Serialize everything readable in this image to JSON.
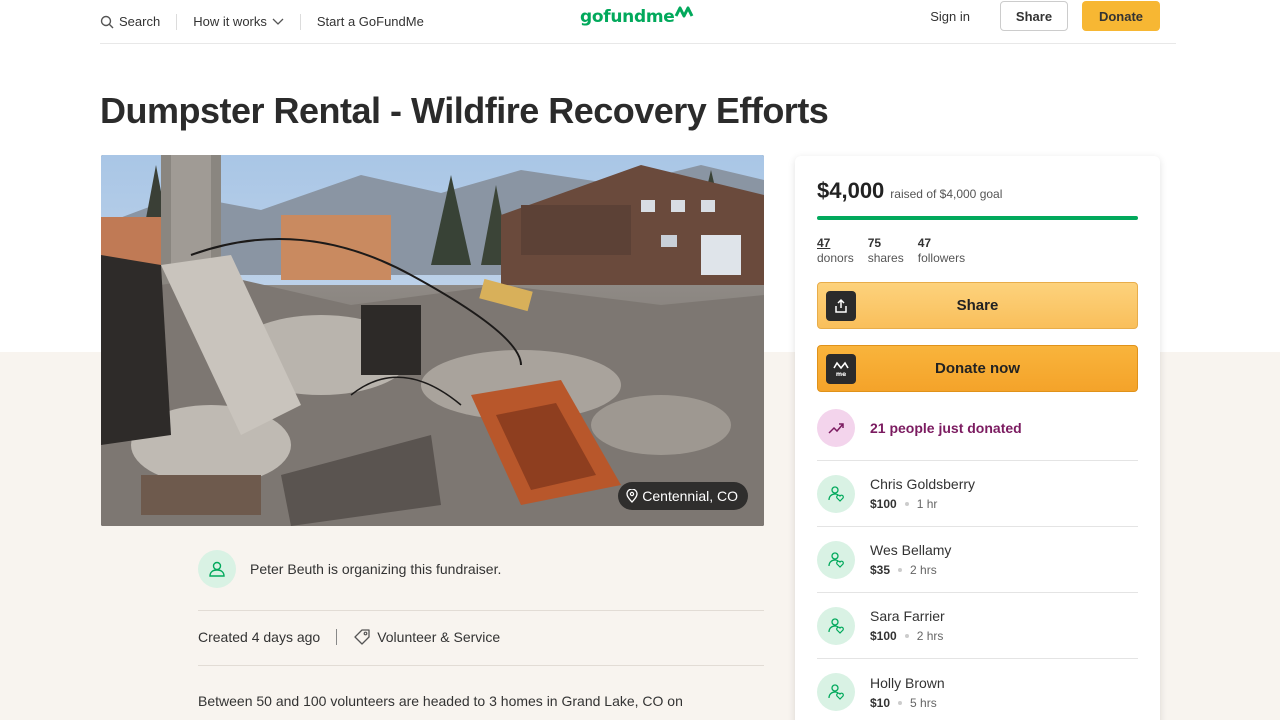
{
  "header": {
    "search_label": "Search",
    "how_label": "How it works",
    "start_label": "Start a GoFundMe",
    "logo_text": "gofundme",
    "signin_label": "Sign in",
    "share_label": "Share",
    "donate_label": "Donate"
  },
  "campaign": {
    "title": "Dumpster Rental - Wildfire Recovery Efforts",
    "location": "Centennial, CO",
    "organizer_text": "Peter Beuth is organizing this fundraiser.",
    "created": "Created 4 days ago",
    "category": "Volunteer & Service",
    "story": "Between 50 and 100 volunteers are headed to 3 homes in Grand Lake, CO on"
  },
  "sidebar": {
    "amount": "$4,000",
    "goal_text": "raised of $4,000 goal",
    "progress": 1.0,
    "stats": [
      {
        "value": "47",
        "label": "donors"
      },
      {
        "value": "75",
        "label": "shares"
      },
      {
        "value": "47",
        "label": "followers"
      }
    ],
    "share_button": "Share",
    "donate_button": "Donate now",
    "recent_text": "21 people just donated",
    "donations": [
      {
        "name": "Chris Goldsberry",
        "amount": "$100",
        "time": "1 hr"
      },
      {
        "name": "Wes Bellamy",
        "amount": "$35",
        "time": "2 hrs"
      },
      {
        "name": "Sara Farrier",
        "amount": "$100",
        "time": "2 hrs"
      },
      {
        "name": "Holly Brown",
        "amount": "$10",
        "time": "5 hrs"
      }
    ]
  },
  "colors": {
    "brand_green": "#02a95c",
    "donate_yellow": "#f7b733",
    "recent_purple": "#7b1b60"
  }
}
